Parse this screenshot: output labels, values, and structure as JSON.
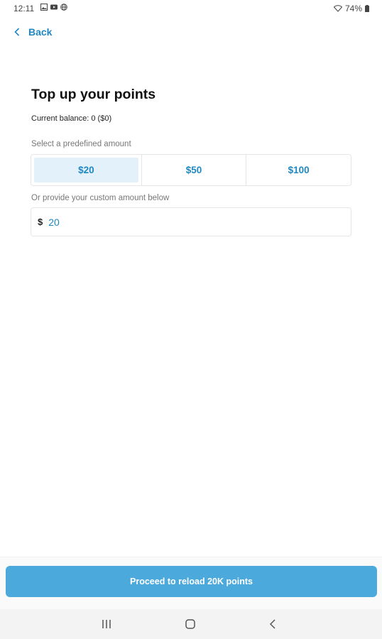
{
  "status_bar": {
    "time": "12:11",
    "battery": "74%"
  },
  "header": {
    "back_label": "Back"
  },
  "main": {
    "title": "Top up your points",
    "balance": "Current balance: 0 ($0)",
    "predefined_label": "Select a predefined amount",
    "amounts": [
      "$20",
      "$50",
      "$100"
    ],
    "selected_amount": "$20",
    "custom_label": "Or provide your custom amount below",
    "currency_symbol": "$",
    "custom_value": "20"
  },
  "footer": {
    "proceed_label": "Proceed to reload 20K points"
  },
  "colors": {
    "accent": "#1f87c3",
    "button": "#4ba9dc",
    "selected_bg": "#e3f1fa"
  }
}
